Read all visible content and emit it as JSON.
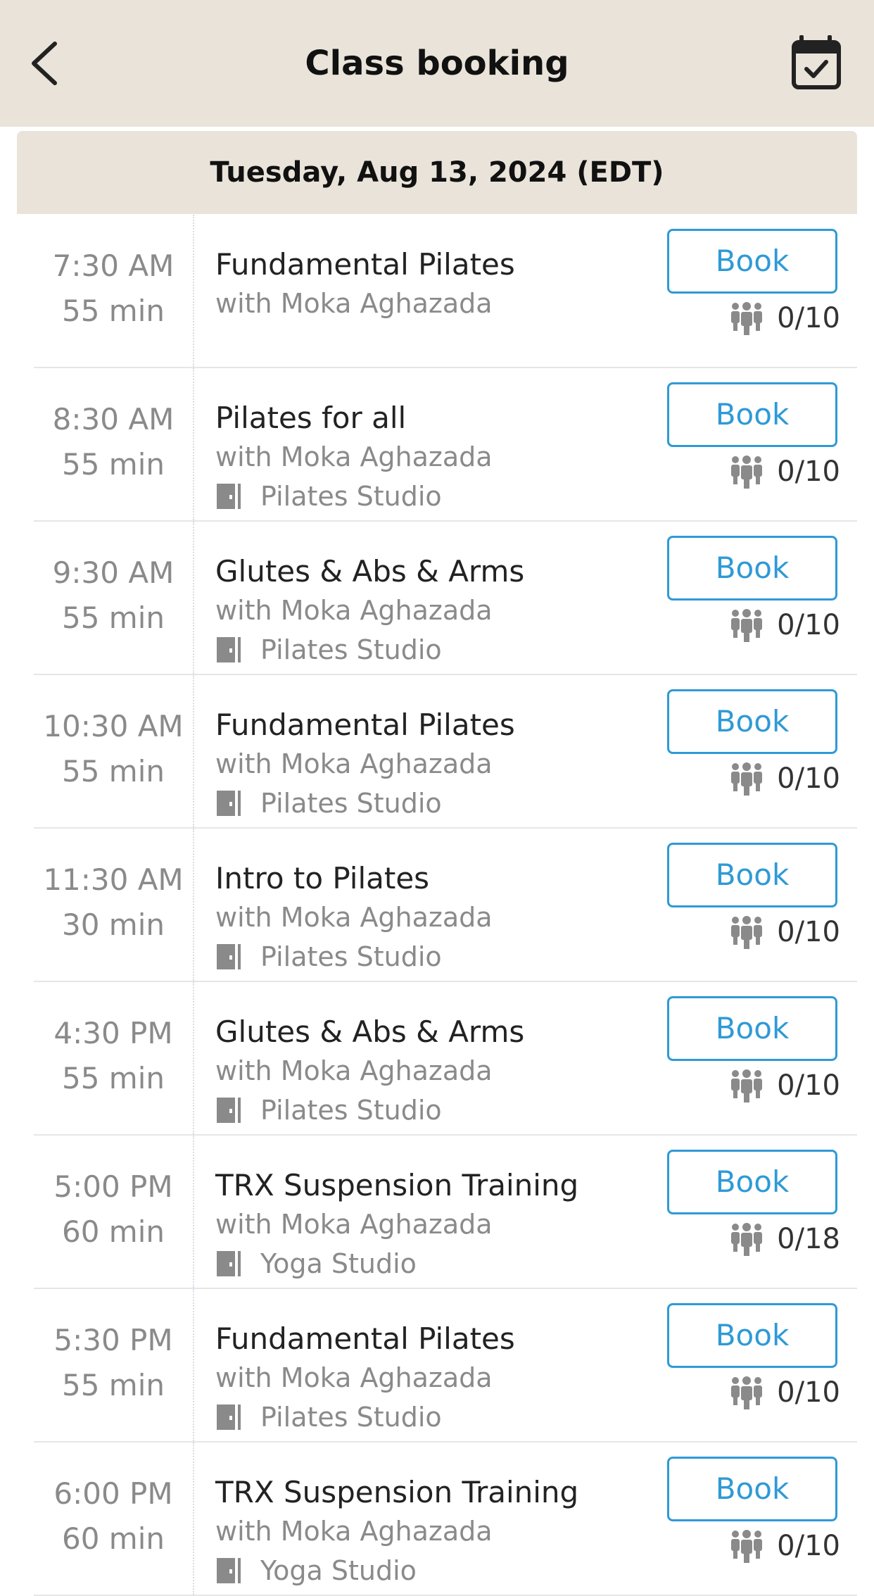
{
  "header": {
    "title": "Class booking",
    "back_icon": "chevron-left-icon",
    "calendar_icon": "calendar-check-icon"
  },
  "date_label": "Tuesday, Aug 13, 2024 (EDT)",
  "colors": {
    "header_bg": "#e9e3d9",
    "accent": "#2f9ad6",
    "muted_text": "#8a8a8a"
  },
  "classes": [
    {
      "time": "7:30  AM",
      "duration": "55 min",
      "name": "Fundamental Pilates",
      "instructor": "with Moka Aghazada",
      "location": "",
      "book_label": "Book",
      "capacity": "0/10"
    },
    {
      "time": "8:30  AM",
      "duration": "55 min",
      "name": "Pilates for all",
      "instructor": "with Moka Aghazada",
      "location": "Pilates Studio",
      "book_label": "Book",
      "capacity": "0/10"
    },
    {
      "time": "9:30  AM",
      "duration": "55 min",
      "name": "Glutes & Abs & Arms",
      "instructor": "with Moka Aghazada",
      "location": "Pilates Studio",
      "book_label": "Book",
      "capacity": "0/10"
    },
    {
      "time": "10:30  AM",
      "duration": "55 min",
      "name": "Fundamental Pilates",
      "instructor": "with Moka Aghazada",
      "location": "Pilates Studio",
      "book_label": "Book",
      "capacity": "0/10"
    },
    {
      "time": "11:30  AM",
      "duration": "30 min",
      "name": "Intro to Pilates",
      "instructor": "with Moka Aghazada",
      "location": "Pilates Studio",
      "book_label": "Book",
      "capacity": "0/10"
    },
    {
      "time": "4:30  PM",
      "duration": "55 min",
      "name": "Glutes & Abs & Arms",
      "instructor": "with Moka Aghazada",
      "location": "Pilates Studio",
      "book_label": "Book",
      "capacity": "0/10"
    },
    {
      "time": "5:00  PM",
      "duration": "60 min",
      "name": "TRX Suspension Training",
      "instructor": "with Moka Aghazada",
      "location": "Yoga Studio",
      "book_label": "Book",
      "capacity": "0/18"
    },
    {
      "time": "5:30  PM",
      "duration": "55 min",
      "name": "Fundamental Pilates",
      "instructor": "with Moka Aghazada",
      "location": "Pilates Studio",
      "book_label": "Book",
      "capacity": "0/10"
    },
    {
      "time": "6:00  PM",
      "duration": "60 min",
      "name": "TRX Suspension Training",
      "instructor": "with Moka Aghazada",
      "location": "Yoga Studio",
      "book_label": "Book",
      "capacity": "0/10"
    }
  ]
}
